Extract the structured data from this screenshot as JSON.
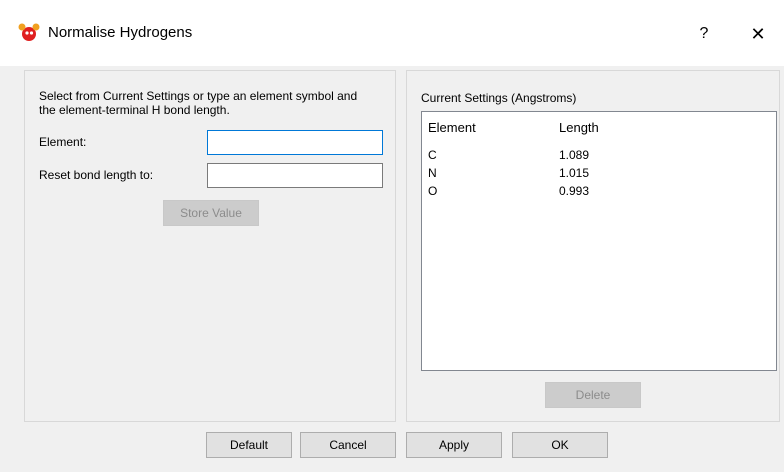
{
  "window": {
    "title": "Normalise Hydrogens",
    "help_label": "?",
    "close_label": "✕"
  },
  "left": {
    "instructions": "Select from Current Settings or type an element symbol and the element-terminal H bond length.",
    "element_label": "Element:",
    "element_value": "",
    "reset_label": "Reset bond length to:",
    "reset_value": "",
    "store_label": "Store Value"
  },
  "right": {
    "title": "Current Settings (Angstroms)",
    "columns": [
      "Element",
      "Length"
    ],
    "rows": [
      {
        "element": "C",
        "length": "1.089"
      },
      {
        "element": "N",
        "length": "1.015"
      },
      {
        "element": "O",
        "length": "0.993"
      }
    ],
    "delete_label": "Delete"
  },
  "footer": {
    "default_label": "Default",
    "cancel_label": "Cancel",
    "apply_label": "Apply",
    "ok_label": "OK"
  },
  "icons": {
    "app": "molecule-icon"
  },
  "colors": {
    "focus_border": "#0078d7",
    "disabled_text": "#8c8c8c"
  }
}
